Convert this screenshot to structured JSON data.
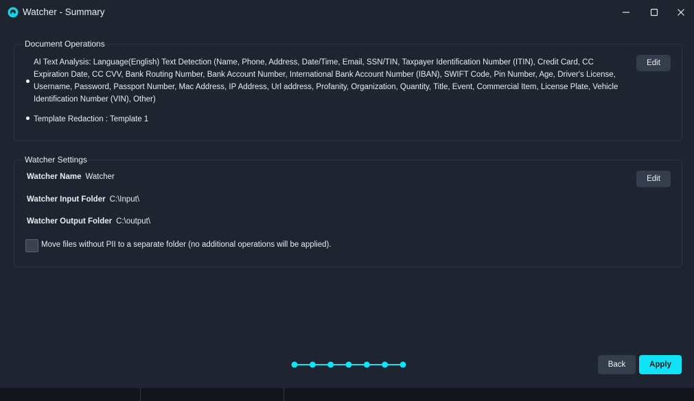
{
  "window": {
    "title": "Watcher - Summary"
  },
  "document_operations": {
    "title": "Document Operations",
    "items": [
      "AI Text Analysis: Language(English) Text Detection (Name, Phone, Address, Date/Time, Email, SSN/TIN, Taxpayer Identification Number (ITIN), Credit Card, CC Expiration Date, CC CVV, Bank Routing Number, Bank Account Number, International Bank Account Number (IBAN), SWIFT Code, Pin Number, Age, Driver's License, Username, Password, Passport Number, Mac Address, IP Address, Url address, Profanity, Organization, Quantity, Title, Event, Commercial Item, License Plate, Vehicle Identification Number (VIN), Other)",
      "Template Redaction : Template 1"
    ],
    "edit_label": "Edit"
  },
  "watcher_settings": {
    "title": "Watcher Settings",
    "name_label": "Watcher Name",
    "name_value": "Watcher",
    "input_label": "Watcher Input Folder",
    "input_value": "C:\\Input\\",
    "output_label": "Watcher Output Folder",
    "output_value": "C:\\output\\",
    "move_files_label": "Move files without PII to a separate folder (no additional operations will be applied).",
    "move_files_checked": false,
    "edit_label": "Edit"
  },
  "wizard": {
    "steps_total": 7,
    "current_step": 7,
    "accent_color": "#0fe3f5"
  },
  "actions": {
    "back_label": "Back",
    "apply_label": "Apply"
  },
  "icons": {
    "app": "watcher-app-icon",
    "minimize": "minimize-icon",
    "maximize": "maximize-icon",
    "close": "close-icon"
  }
}
